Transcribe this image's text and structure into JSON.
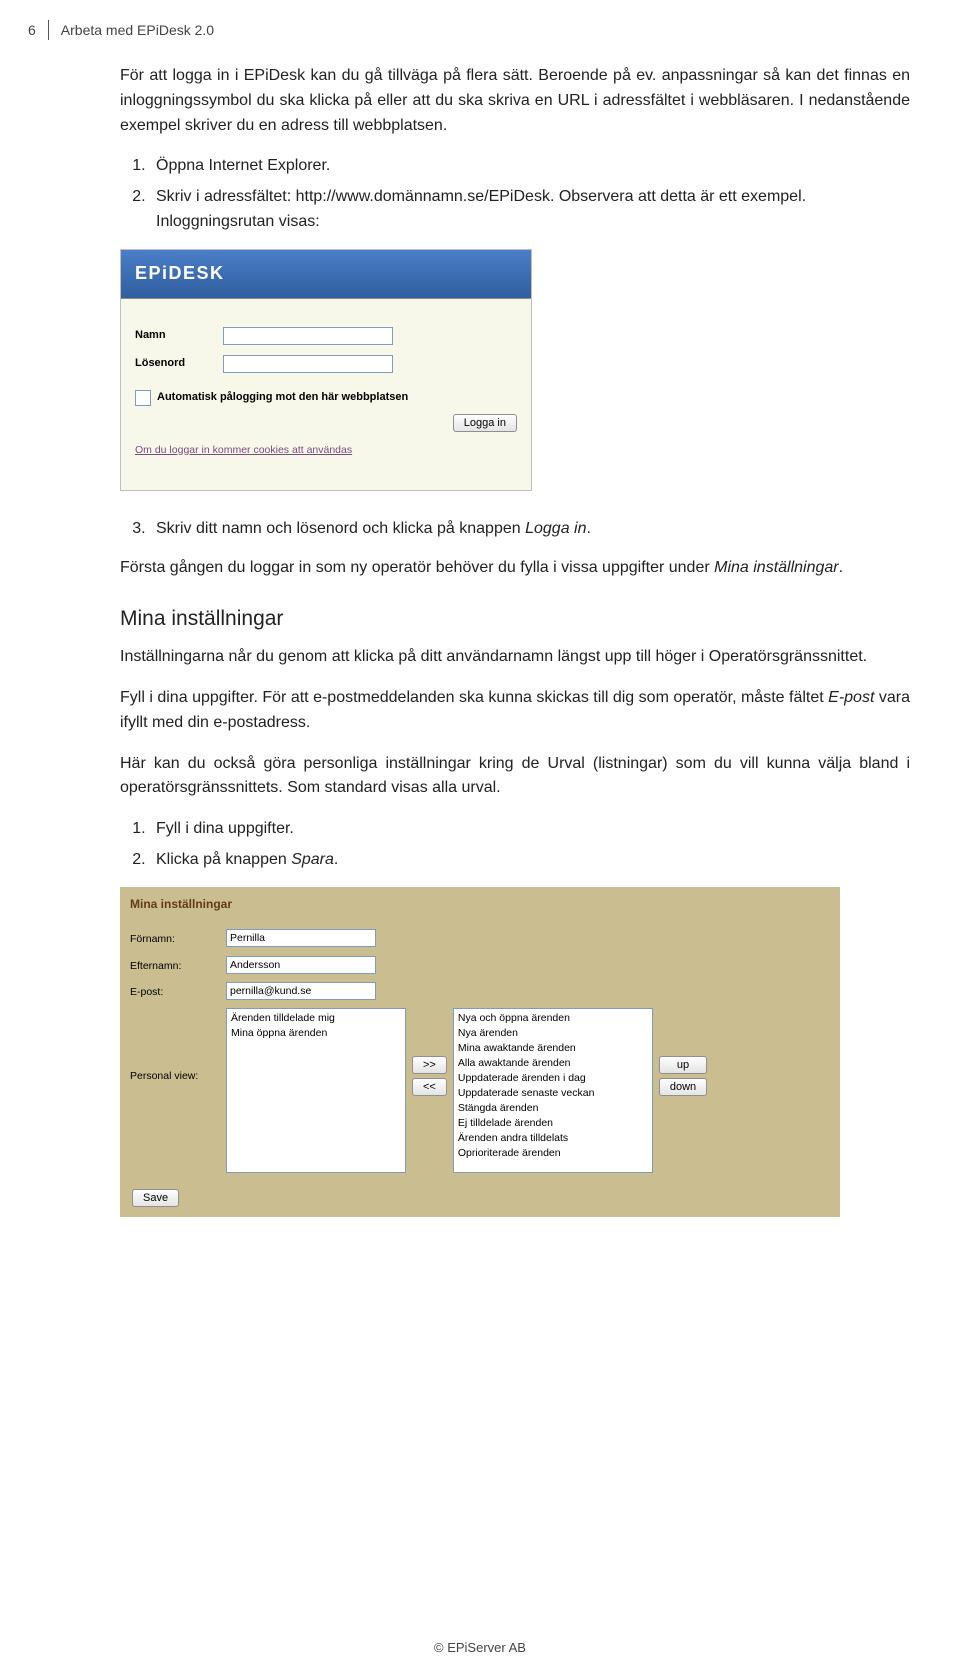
{
  "header": {
    "page_number": "6",
    "title": "Arbeta med EPiDesk 2.0"
  },
  "intro_p1": "För att logga in i EPiDesk kan du gå tillväga på flera sätt. Beroende på ev. anpassningar så kan det finnas en inloggningssymbol du ska klicka på eller att du ska skriva en URL i adressfältet i webbläsaren. I nedanstående exempel skriver du en adress till webbplatsen.",
  "steps1": {
    "s1": "Öppna Internet Explorer.",
    "s2": "Skriv i adressfältet: http://www.domännamn.se/EPiDesk. Observera att detta är ett exempel. Inloggningsrutan visas:"
  },
  "login": {
    "brand": "EPiDESK",
    "name_label": "Namn",
    "pass_label": "Lösenord",
    "auto_label": "Automatisk pålogging mot den här webbplatsen",
    "button": "Logga in",
    "cookie_note": "Om du loggar in kommer cookies att användas"
  },
  "step3_prefix": "Skriv ditt namn och lösenord och klicka på knappen ",
  "step3_btn": "Logga in",
  "step3_suffix": ".",
  "after_login_prefix": "Första gången du loggar in som ny operatör behöver du fylla i vissa uppgifter under ",
  "after_login_em": "Mina inställningar",
  "after_login_suffix": ".",
  "h2": "Mina inställningar",
  "mi_p1": "Inställningarna når du genom att klicka på ditt användarnamn längst upp till höger i Operatörsgränssnittet.",
  "mi_p2_prefix": "Fyll i dina uppgifter. För att e-postmeddelanden ska kunna skickas till dig som operatör, måste fältet ",
  "mi_p2_em": "E-post",
  "mi_p2_suffix": " vara ifyllt med din e-postadress.",
  "mi_p3": "Här kan du också göra personliga inställningar kring de Urval (listningar) som du vill kunna välja bland i operatörsgränssnittets. Som standard visas alla urval.",
  "steps2": {
    "s1": "Fyll i dina uppgifter.",
    "s2_prefix": "Klicka på knappen ",
    "s2_em": "Spara",
    "s2_suffix": "."
  },
  "settings": {
    "title": "Mina inställningar",
    "labels": {
      "fname": "Förnamn:",
      "lname": "Efternamn:",
      "email": "E-post:",
      "pview": "Personal view:"
    },
    "values": {
      "fname": "Pernilla",
      "lname": "Andersson",
      "email": "pernilla@kund.se"
    },
    "left_list": [
      "Ärenden tilldelade mig",
      "Mina öppna ärenden"
    ],
    "right_list": [
      "Nya och öppna ärenden",
      "Nya ärenden",
      "Mina awaktande ärenden",
      "Alla awaktande ärenden",
      "Uppdaterade ärenden i dag",
      "Uppdaterade senaste veckan",
      "Stängda ärenden",
      "Ej tilldelade ärenden",
      "Ärenden andra tilldelats",
      "Oprioriterade ärenden"
    ],
    "btn_right": ">>",
    "btn_left": "<<",
    "btn_up": "up",
    "btn_down": "down",
    "btn_save": "Save"
  },
  "footer": "© EPiServer AB"
}
